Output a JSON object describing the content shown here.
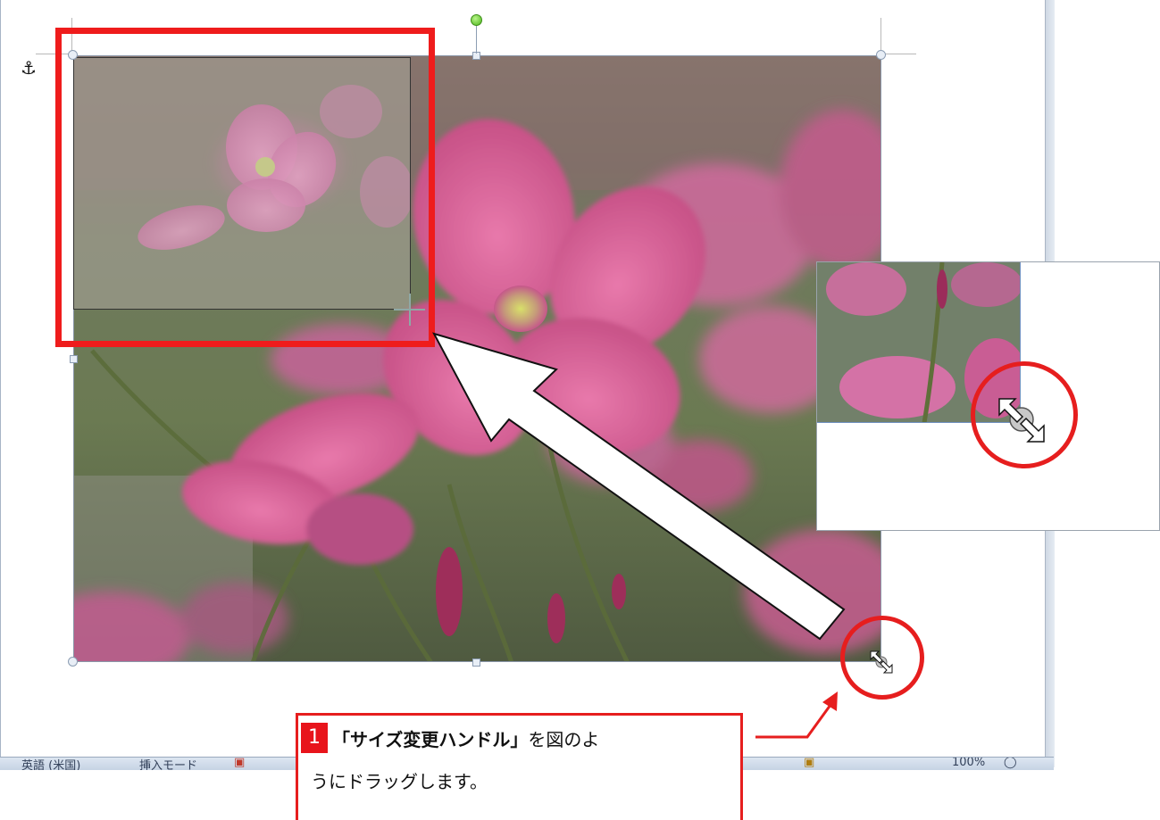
{
  "callout": {
    "step_number": "1",
    "text_bold": "「サイズ変更ハンドル」",
    "text_rest": "を図のよ",
    "text_line2": "うにドラッグします。"
  },
  "status_bar": {
    "language": "英語 (米国)",
    "insert_mode": "挿入モード",
    "zoom_level": "100%"
  },
  "icons": {
    "anchor": "anchor-icon",
    "resize_cursor": "resize-diagonal-icon",
    "rotate": "rotate-handle-icon"
  },
  "colors": {
    "highlight_red": "#ef1c1c",
    "handle_fill": "#e8eef6",
    "handle_border": "#8c9db3",
    "flower_pink": "#d9588f"
  }
}
